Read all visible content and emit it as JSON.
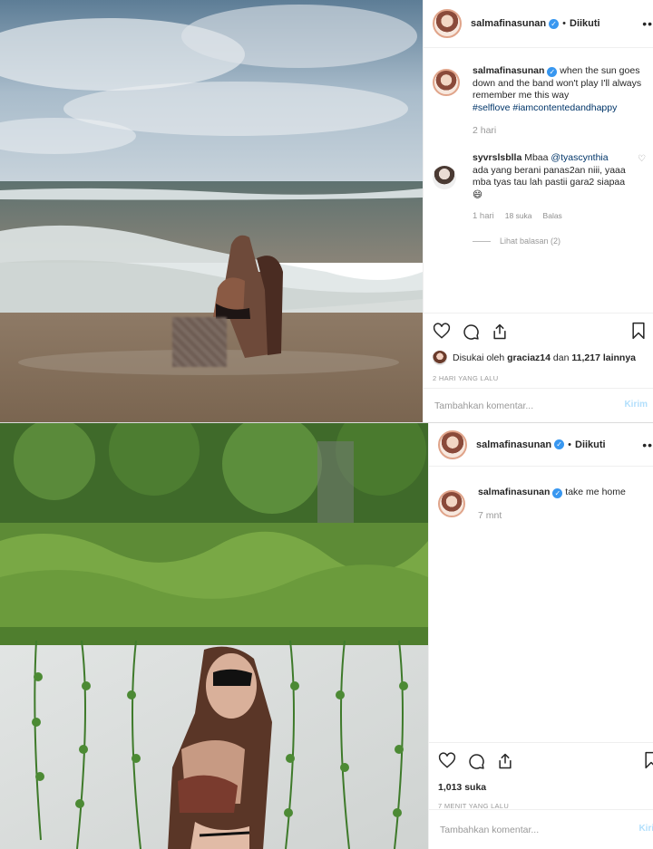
{
  "post1": {
    "username": "salmafinasunan",
    "follow_status": "Diikuti",
    "caption_user": "salmafinasunan",
    "caption_text": "when the sun goes down and the band won't play I'll always remember me this way",
    "hashtags": "#selflove #iamcontentedandhappy",
    "caption_time": "2 hari",
    "comment": {
      "user": "syvrslsblla",
      "text_start": "Mbaa",
      "mention": "@tyascynthia",
      "text_end": "ada yang berani panas2an niii, yaaa mba tyas tau lah pastii gara2 siapaa😄",
      "time": "1 hari",
      "likes": "18 suka",
      "reply": "Balas",
      "view_replies": "Lihat balasan (2)"
    },
    "liked_by_prefix": "Disukai oleh",
    "liked_by_user": "graciaz14",
    "liked_by_suffix": "dan",
    "liked_by_count": "11,217 lainnya",
    "post_time": "2 HARI YANG LALU",
    "comment_placeholder": "Tambahkan komentar...",
    "send_label": "Kirim"
  },
  "post2": {
    "username": "salmafinasunan",
    "follow_status": "Diikuti",
    "caption_user": "salmafinasunan",
    "caption_text": "take me home",
    "caption_time": "7 mnt",
    "likes": "1,013 suka",
    "post_time": "7 MENIT YANG LALU",
    "comment_placeholder": "Tambahkan komentar...",
    "send_label": "Kirim"
  }
}
